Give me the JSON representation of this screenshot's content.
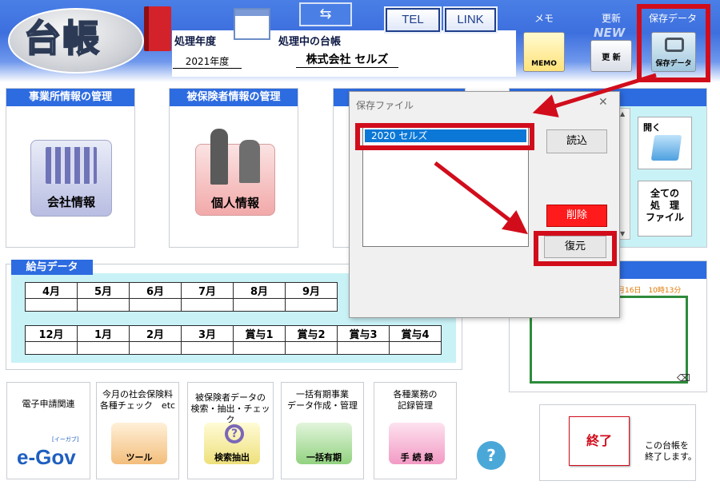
{
  "header": {
    "logo_text": "台帳",
    "year_label": "処理年度",
    "year_value": "2021年度",
    "current_label": "処理中の台帳",
    "current_value": "株式会社 セルズ",
    "tel_button": "TEL",
    "link_button": "LINK",
    "memo_top": "メモ",
    "memo_icon": "MEMO",
    "update_top": "更新",
    "update_badge": "NEW",
    "update_icon": "更 新",
    "save_top": "保存データ",
    "save_icon": "保存データ"
  },
  "panels": {
    "office": {
      "title": "事業所情報の管理",
      "icon_label": "会社情報"
    },
    "insured": {
      "title": "被保険者情報の管理",
      "icon_label": "個人情報"
    }
  },
  "right_panel": {
    "open_label": "開く",
    "all_files_label": "全ての\n処　理\nファイル"
  },
  "memo_area": {
    "timestamp": "月16日　10時13分"
  },
  "salary": {
    "title": "給与データ",
    "row1": [
      "4月",
      "5月",
      "6月",
      "7月",
      "8月",
      "9月"
    ],
    "row2": [
      "12月",
      "1月",
      "2月",
      "3月",
      "賞与1",
      "賞与2",
      "賞与3",
      "賞与4"
    ]
  },
  "bottom": {
    "egov": {
      "label": "電子申請関連",
      "icon_text": "e-Gov",
      "icon_sub": "[イーガブ]"
    },
    "check": {
      "label": "今月の社会保険料\n各種チェック　etc",
      "icon_text": "ツール"
    },
    "search": {
      "label": "被保険者データの\n検索・抽出・チェック",
      "icon_text": "検索抽出"
    },
    "bulk": {
      "label": "一括有期事業\nデータ作成・管理",
      "icon_text": "一括有期"
    },
    "record": {
      "label": "各種業務の\n記録管理",
      "icon_text": "手 続 録"
    },
    "help": "?",
    "exit_button": "終了",
    "exit_desc": "この台帳を\n終了します。"
  },
  "dialog": {
    "title": "保存ファイル",
    "close": "✕",
    "items": [
      "2020 セルズ"
    ],
    "load_button": "読込",
    "delete_button": "削除",
    "restore_button": "復元"
  },
  "colors": {
    "header_blue": "#4a7fe6",
    "panel_title_blue": "#2d6be0",
    "highlight_red": "#d10d1c",
    "selection_blue": "#0b78d7"
  }
}
